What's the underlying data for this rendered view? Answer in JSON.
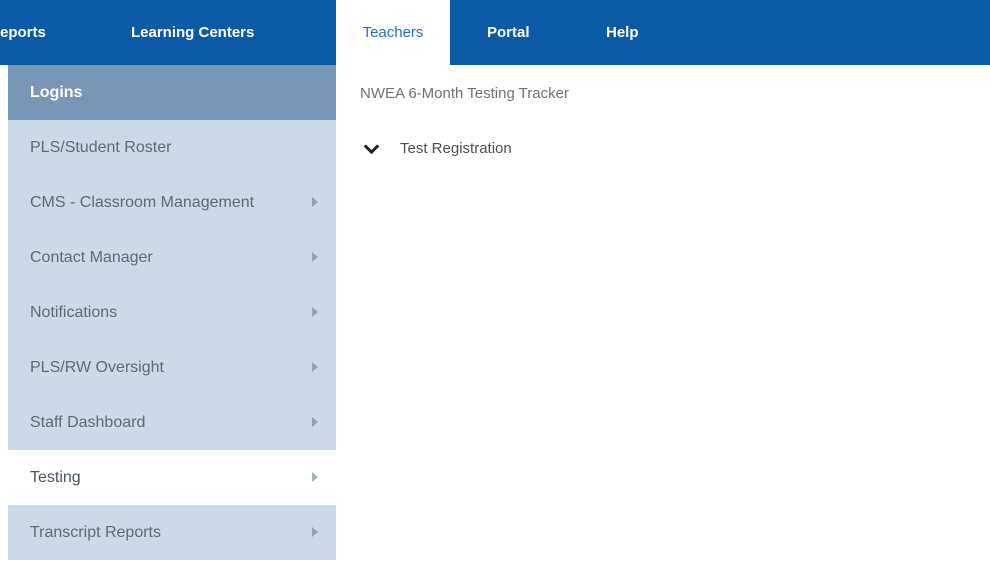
{
  "topnav": {
    "items": [
      {
        "label": "eports"
      },
      {
        "label": "Learning Centers"
      },
      {
        "label": "Teachers"
      },
      {
        "label": "Portal"
      },
      {
        "label": "Help"
      }
    ],
    "active": "Teachers"
  },
  "sidebar": {
    "items": [
      {
        "label": "Logins"
      },
      {
        "label": "PLS/Student Roster"
      },
      {
        "label": "CMS - Classroom Management",
        "icon": "chevron-right-icon"
      },
      {
        "label": "Contact Manager",
        "icon": "chevron-right-icon"
      },
      {
        "label": "Notifications",
        "icon": "chevron-right-icon"
      },
      {
        "label": "PLS/RW Oversight",
        "icon": "chevron-right-icon"
      },
      {
        "label": "Staff Dashboard",
        "icon": "chevron-right-icon"
      },
      {
        "label": "Testing",
        "icon": "chevron-right-icon"
      },
      {
        "label": "Transcript Reports",
        "icon": "chevron-right-icon"
      }
    ]
  },
  "main": {
    "title": "NWEA 6-Month Testing Tracker",
    "section": {
      "label": "Test Registration",
      "icon": "chevron-down-icon"
    }
  },
  "colors": {
    "nav_bg": "#0c5aa6",
    "sidebar_bg": "#ccd9e7",
    "sidebar_header_bg": "#7896b6"
  }
}
